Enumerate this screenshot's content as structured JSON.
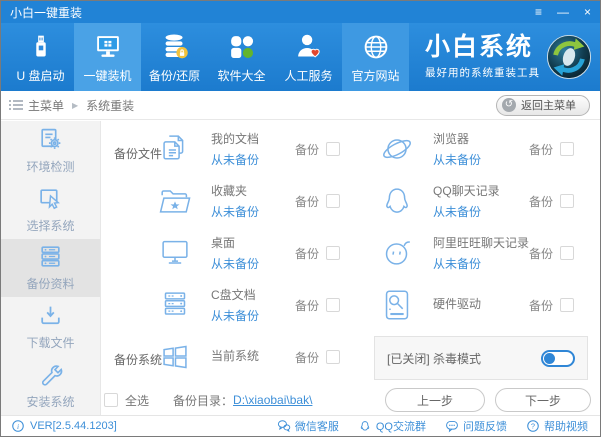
{
  "window": {
    "title": "小白一键重装",
    "controls": {
      "menu": "≡",
      "minimize": "—",
      "close": "×"
    }
  },
  "nav": {
    "items": [
      {
        "label": "U 盘启动",
        "icon": "usb-icon",
        "active": false
      },
      {
        "label": "一键装机",
        "icon": "monitor-icon",
        "active": true
      },
      {
        "label": "备份/还原",
        "icon": "database-icon",
        "active": false
      },
      {
        "label": "软件大全",
        "icon": "apps-icon",
        "active": false
      },
      {
        "label": "人工服务",
        "icon": "person-icon",
        "active": false
      },
      {
        "label": "官方网站",
        "icon": "globe-icon",
        "active": false
      }
    ],
    "brand": {
      "title": "小白系统",
      "subtitle": "最好用的系统重装工具"
    }
  },
  "breadcrumb": {
    "root": "主菜单",
    "separator": "▶",
    "current": "系统重装",
    "back_button": "返回主菜单"
  },
  "sidebar": {
    "items": [
      {
        "label": "环境检测",
        "icon": "env-check-icon",
        "active": false
      },
      {
        "label": "选择系统",
        "icon": "select-system-icon",
        "active": false
      },
      {
        "label": "备份资料",
        "icon": "backup-data-icon",
        "active": true
      },
      {
        "label": "下载文件",
        "icon": "download-icon",
        "active": false
      },
      {
        "label": "安装系统",
        "icon": "install-icon",
        "active": false
      }
    ]
  },
  "main": {
    "backup_files_label": "备份文件",
    "backup_system_label": "备份系统",
    "backup_label": "备份",
    "items_left": [
      {
        "name": "我的文档",
        "status": "从未备份",
        "icon": "documents-icon",
        "checked": false
      },
      {
        "name": "收藏夹",
        "status": "从未备份",
        "icon": "favorites-icon",
        "checked": false
      },
      {
        "name": "桌面",
        "status": "从未备份",
        "icon": "desktop-icon",
        "checked": false
      },
      {
        "name": "C盘文档",
        "status": "从未备份",
        "icon": "cdrive-icon",
        "checked": false
      }
    ],
    "items_right": [
      {
        "name": "浏览器",
        "status": "从未备份",
        "icon": "browser-icon",
        "checked": false
      },
      {
        "name": "QQ聊天记录",
        "status": "从未备份",
        "icon": "qq-icon",
        "checked": false
      },
      {
        "name": "阿里旺旺聊天记录",
        "status": "从未备份",
        "icon": "wangwang-icon",
        "checked": false
      },
      {
        "name": "硬件驱动",
        "status": "",
        "icon": "harddrive-icon",
        "checked": false
      }
    ],
    "current_system": {
      "name": "当前系统",
      "status": "",
      "icon": "windows-icon",
      "checked": false
    },
    "antivirus": {
      "label": "[已关闭] 杀毒模式",
      "enabled": false
    },
    "select_all_label": "全选",
    "select_all_checked": false,
    "backup_dir_label": "备份目录：",
    "backup_dir": "D:\\xiaobai\\bak\\",
    "prev_button": "上一步",
    "next_button": "下一步"
  },
  "footer": {
    "version": "VER[2.5.44.1203]",
    "links": [
      {
        "label": "微信客服",
        "icon": "wechat-icon"
      },
      {
        "label": "QQ交流群",
        "icon": "qq-icon"
      },
      {
        "label": "问题反馈",
        "icon": "feedback-icon"
      },
      {
        "label": "帮助视频",
        "icon": "help-icon"
      }
    ]
  },
  "colors": {
    "titlebar": "#2183d6",
    "header_top": "#2d8ede",
    "header_bottom": "#1c7bce",
    "nav_active": "#4aa2e6",
    "link_blue": "#3d8fd8",
    "icon_blue": "#7ab2e8",
    "sidebar_bg": "#f3f3f3",
    "sidebar_active": "#e3e3e3",
    "apps_green": "#63b42d",
    "heart_red": "#e2472e",
    "badge_yellow": "#f2c23c"
  }
}
